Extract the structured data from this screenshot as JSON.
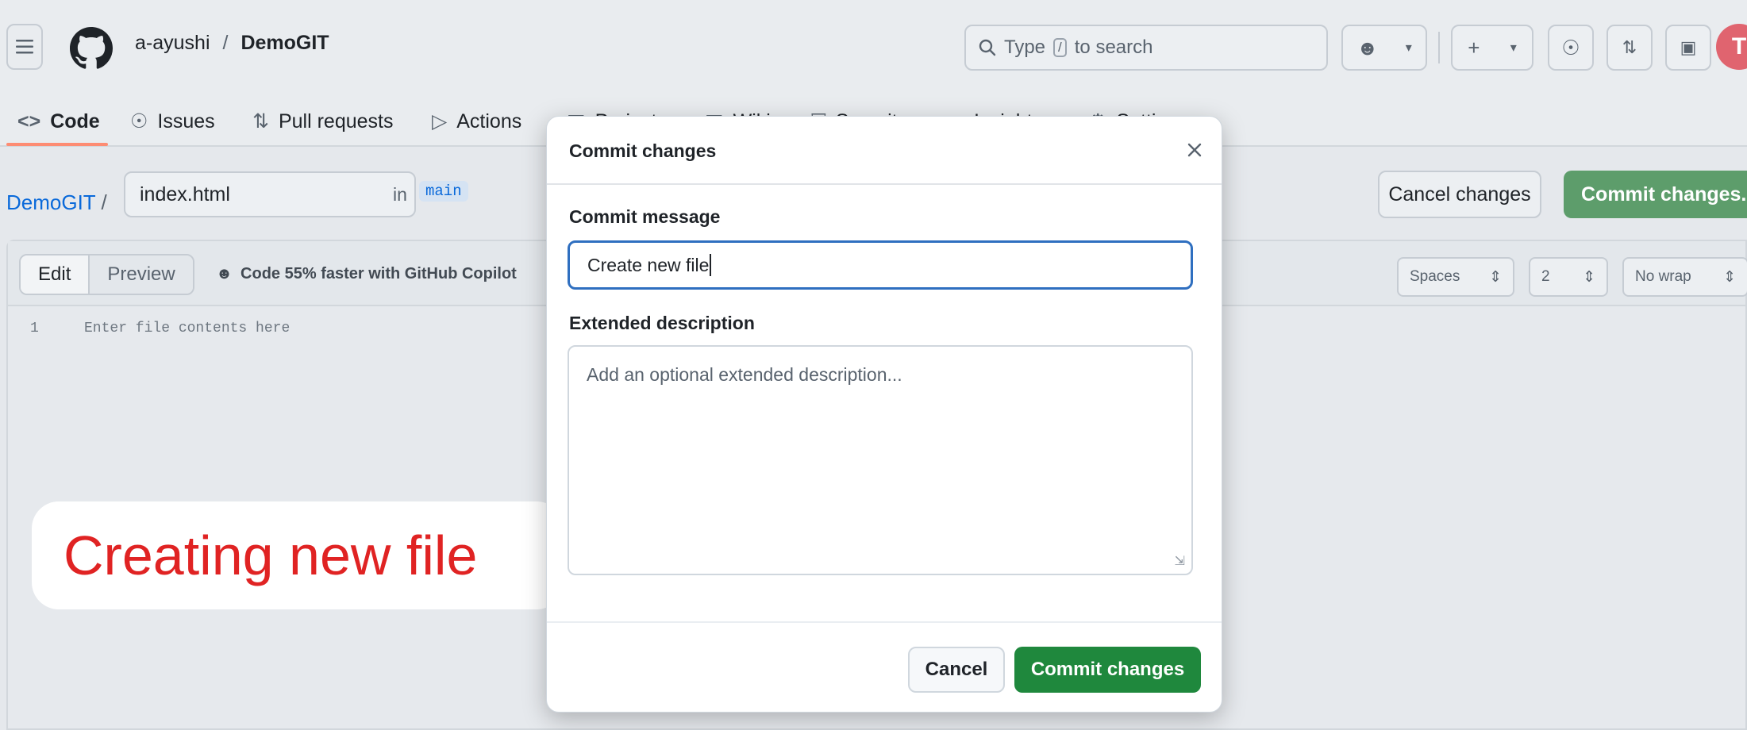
{
  "header": {
    "owner": "a-ayushi",
    "separator": "/",
    "repo": "DemoGIT",
    "search_prefix": "Type",
    "search_key": "/",
    "search_suffix": "to search",
    "avatar_initial": "T"
  },
  "tabs": [
    {
      "label": "Code",
      "icon": "code-icon"
    },
    {
      "label": "Issues",
      "icon": "issue-icon"
    },
    {
      "label": "Pull requests",
      "icon": "pull-request-icon"
    },
    {
      "label": "Actions",
      "icon": "play-icon"
    },
    {
      "label": "Projects",
      "icon": "table-icon"
    },
    {
      "label": "Wiki",
      "icon": "book-icon"
    },
    {
      "label": "Security",
      "icon": "shield-icon"
    },
    {
      "label": "Insights",
      "icon": "graph-icon"
    },
    {
      "label": "Settings",
      "icon": "gear-icon"
    }
  ],
  "path": {
    "repo_link": "DemoGIT",
    "slash": "/",
    "filename": "index.html",
    "in_label": "in",
    "branch": "main"
  },
  "actions": {
    "cancel_changes": "Cancel changes",
    "commit_changes": "Commit changes..."
  },
  "editor": {
    "edit_tab": "Edit",
    "preview_tab": "Preview",
    "copilot_text": "Code 55% faster with GitHub Copilot",
    "indent_mode": "Spaces",
    "indent_size": "2",
    "wrap_mode": "No wrap",
    "line_number": "1",
    "placeholder": "Enter file contents here"
  },
  "annotation": "Creating new file",
  "modal": {
    "title": "Commit changes",
    "commit_message_label": "Commit message",
    "commit_message_value": "Create new file",
    "extended_description_label": "Extended description",
    "extended_description_placeholder": "Add an optional extended description...",
    "cancel_button": "Cancel",
    "commit_button": "Commit changes"
  },
  "colors": {
    "primary_button": "#1f883d",
    "link": "#0969da",
    "annotation_text": "#e02323",
    "focus_border": "#2f6fc0"
  }
}
